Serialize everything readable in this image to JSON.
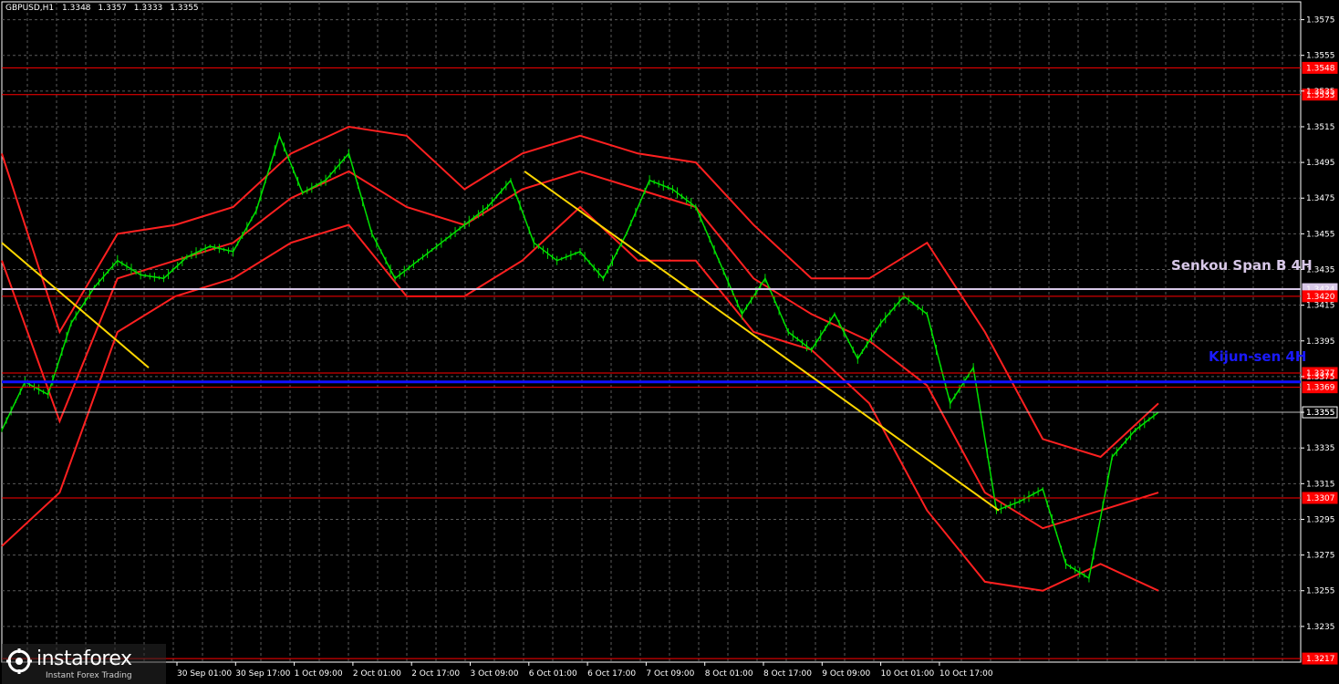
{
  "header": {
    "symbol": "GBPUSD,H1",
    "ohlc": [
      "1.3348",
      "1.3357",
      "1.3333",
      "1.3355"
    ]
  },
  "logo": {
    "brand": "instaforex",
    "tagline": "Instant Forex Trading"
  },
  "chart_data": {
    "type": "line",
    "title": "GBPUSD,H1",
    "price_range": [
      1.3215,
      1.3585
    ],
    "y_ticks": [
      "1.3575",
      "1.3555",
      "1.3535",
      "1.3515",
      "1.3495",
      "1.3475",
      "1.3455",
      "1.3435",
      "1.3415",
      "1.3395",
      "1.3375",
      "1.3355",
      "1.3335",
      "1.3315",
      "1.3295",
      "1.3275",
      "1.3255",
      "1.3235"
    ],
    "x_labels": [
      "30 Sep 01:00",
      "30 Sep 17:00",
      "1 Oct 09:00",
      "2 Oct 01:00",
      "2 Oct 17:00",
      "3 Oct 09:00",
      "6 Oct 01:00",
      "6 Oct 17:00",
      "7 Oct 09:00",
      "8 Oct 01:00",
      "8 Oct 17:00",
      "9 Oct 09:00",
      "10 Oct 01:00",
      "10 Oct 17:00"
    ],
    "levels": [
      {
        "name": "level-1-3548",
        "value": 1.3548,
        "label": "1.3548",
        "color": "#ff0000"
      },
      {
        "name": "level-1-3533",
        "value": 1.3533,
        "label": "1.3533",
        "color": "#ff0000"
      },
      {
        "name": "senkou-span-b",
        "value": 1.3424,
        "label": "1.3424",
        "color": "#d8c8e8"
      },
      {
        "name": "level-1-3420",
        "value": 1.342,
        "label": "1.3420",
        "color": "#ff0000"
      },
      {
        "name": "level-1-3377",
        "value": 1.3377,
        "label": "1.3377",
        "color": "#ff0000"
      },
      {
        "name": "kijun-sen",
        "value": 1.3372,
        "label": "",
        "color": "#1010ff"
      },
      {
        "name": "level-1-3369",
        "value": 1.3369,
        "label": "1.3369",
        "color": "#ff0000"
      },
      {
        "name": "current-price",
        "value": 1.3355,
        "label": "1.3355",
        "color": "#c0c0c0"
      },
      {
        "name": "level-1-3307",
        "value": 1.3307,
        "label": "1.3307",
        "color": "#ff0000"
      },
      {
        "name": "level-1-3217",
        "value": 1.3217,
        "label": "1.3217",
        "color": "#ff0000"
      }
    ],
    "annotations": [
      {
        "text": "Senkou Span B 4H",
        "color": "#d8c8e8"
      },
      {
        "text": "Kijun-sen 4H",
        "color": "#1a1aff"
      }
    ],
    "series": [
      {
        "type": "line",
        "color": "#00e000",
        "x": [
          0,
          0.02,
          0.04,
          0.06,
          0.08,
          0.1,
          0.12,
          0.14,
          0.16,
          0.18,
          0.2,
          0.22,
          0.24,
          0.26,
          0.28,
          0.3,
          0.32,
          0.34,
          0.36,
          0.38,
          0.4,
          0.42,
          0.44,
          0.46,
          0.48,
          0.5,
          0.52,
          0.54,
          0.56,
          0.58,
          0.6,
          0.62,
          0.64,
          0.66,
          0.68,
          0.7,
          0.72,
          0.74,
          0.76,
          0.78,
          0.8,
          0.82,
          0.84,
          0.86,
          0.88,
          0.9,
          0.92,
          0.94,
          0.96,
          0.98,
          1.0
        ],
        "y": [
          1.3345,
          1.3372,
          1.3365,
          1.3405,
          1.3425,
          1.344,
          1.3432,
          1.343,
          1.3442,
          1.3448,
          1.3445,
          1.3468,
          1.351,
          1.3478,
          1.3485,
          1.35,
          1.3455,
          1.343,
          1.344,
          1.345,
          1.346,
          1.347,
          1.3485,
          1.345,
          1.344,
          1.3445,
          1.343,
          1.3455,
          1.3485,
          1.348,
          1.347,
          1.344,
          1.341,
          1.343,
          1.34,
          1.339,
          1.341,
          1.3385,
          1.3405,
          1.342,
          1.341,
          1.336,
          1.338,
          1.33,
          1.3305,
          1.3312,
          1.327,
          1.3262,
          1.333,
          1.3345,
          1.3355
        ]
      },
      {
        "type": "line",
        "color": "#ff2020",
        "x": [
          0,
          0.05,
          0.1,
          0.15,
          0.2,
          0.25,
          0.3,
          0.35,
          0.4,
          0.45,
          0.5,
          0.55,
          0.6,
          0.65,
          0.7,
          0.75,
          0.8,
          0.85,
          0.9,
          0.95,
          1.0
        ],
        "y": [
          1.344,
          1.335,
          1.343,
          1.344,
          1.345,
          1.3475,
          1.349,
          1.347,
          1.346,
          1.348,
          1.349,
          1.348,
          1.347,
          1.343,
          1.341,
          1.3395,
          1.337,
          1.331,
          1.329,
          1.33,
          1.331
        ]
      },
      {
        "type": "line",
        "color": "#ff2020",
        "x": [
          0,
          0.05,
          0.1,
          0.15,
          0.2,
          0.25,
          0.3,
          0.35,
          0.4,
          0.45,
          0.5,
          0.55,
          0.6,
          0.65,
          0.7,
          0.75,
          0.8,
          0.85,
          0.9,
          0.95,
          1.0
        ],
        "y": [
          1.35,
          1.34,
          1.3455,
          1.346,
          1.347,
          1.35,
          1.3515,
          1.351,
          1.348,
          1.35,
          1.351,
          1.35,
          1.3495,
          1.346,
          1.343,
          1.343,
          1.345,
          1.34,
          1.334,
          1.333,
          1.336
        ]
      },
      {
        "type": "line",
        "color": "#ff2020",
        "x": [
          0,
          0.05,
          0.1,
          0.15,
          0.2,
          0.25,
          0.3,
          0.35,
          0.4,
          0.45,
          0.5,
          0.55,
          0.6,
          0.65,
          0.7,
          0.75,
          0.8,
          0.85,
          0.9,
          0.95,
          1.0
        ],
        "y": [
          1.328,
          1.331,
          1.34,
          1.342,
          1.343,
          1.345,
          1.346,
          1.342,
          1.342,
          1.344,
          1.347,
          1.344,
          1.344,
          1.34,
          1.339,
          1.336,
          1.33,
          1.326,
          1.3255,
          1.327,
          1.3255
        ]
      },
      {
        "type": "trendline",
        "color": "#ffd700",
        "x": [
          0,
          0.127
        ],
        "y": [
          1.345,
          1.338
        ]
      },
      {
        "type": "trendline",
        "color": "#ffd700",
        "x": [
          0.452,
          0.862
        ],
        "y": [
          1.349,
          1.33
        ]
      }
    ]
  }
}
